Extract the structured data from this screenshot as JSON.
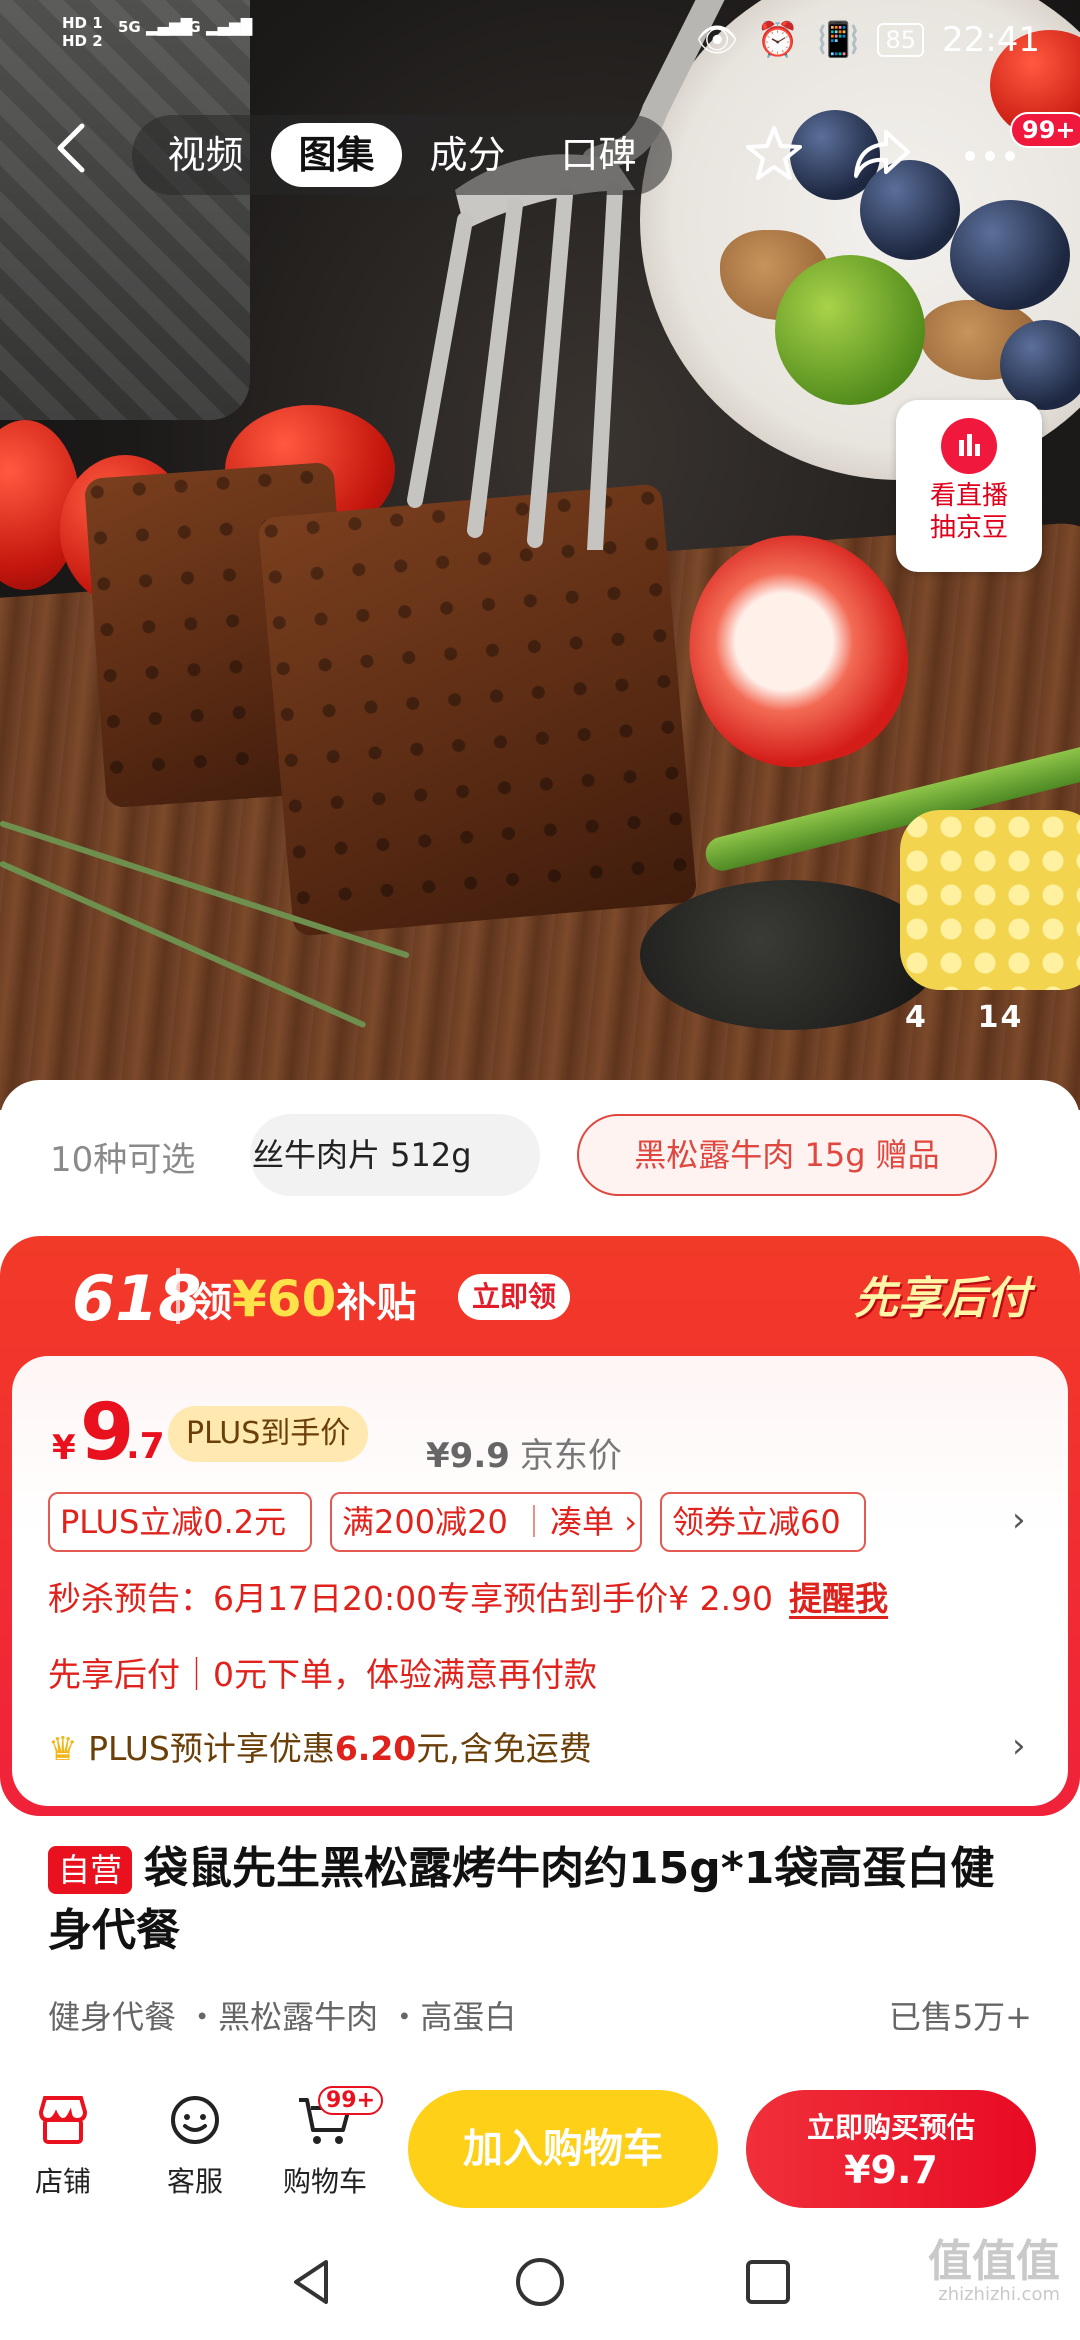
{
  "status_bar": {
    "hd1": "HD 1",
    "hd2": "HD 2",
    "net1": "5G",
    "net2": "4G",
    "battery": "85",
    "time": "22:41"
  },
  "nav": {
    "tabs": [
      "视频",
      "图集",
      "成分",
      "口碑"
    ],
    "active_tab": "图集",
    "more_badge": "99+"
  },
  "live": {
    "line1": "看直播",
    "line2": "抽京豆"
  },
  "gallery": {
    "current": "4",
    "total": "14"
  },
  "variants": {
    "count_label": "10种可选",
    "option1": "丝牛肉片 512g",
    "option2": "黑松露牛肉 15g 赠品"
  },
  "promo": {
    "event": "618",
    "claim_prefix": "领",
    "claim_amount": "¥60",
    "claim_suffix": "补贴",
    "claim_button": "立即领",
    "bnpl": "先享后付"
  },
  "price": {
    "symbol": "¥",
    "integer": "9",
    "decimal": ".7",
    "plus_tag": "PLUS到手价",
    "jd_price": "¥9.9",
    "jd_label": "京东价"
  },
  "coupons": [
    "PLUS立减0.2元",
    "满200减20",
    "凑单",
    "领券立减60"
  ],
  "flash_sale": {
    "text": "秒杀预告：6月17日20:00专享预估到手价¥ 2.90",
    "remind": "提醒我"
  },
  "bnpl_line": "先享后付｜0元下单，体验满意再付款",
  "plus_line": {
    "prefix": "PLUS预计享优惠",
    "value": "6.20",
    "suffix": "元,含免运费"
  },
  "product": {
    "self_tag": "自营",
    "title": "袋鼠先生黑松露烤牛肉约15g*1袋高蛋白健身代餐",
    "features": "健身代餐 ・黑松露牛肉 ・高蛋白",
    "sold": "已售5万+"
  },
  "bottom": {
    "store": "店铺",
    "service": "客服",
    "cart": "购物车",
    "cart_badge": "99+",
    "add_cart": "加入购物车",
    "buy_line1": "立即购买预估",
    "buy_line2": "¥9.7"
  },
  "watermark": {
    "main": "值值值",
    "sub": "zhizhizhi.com"
  },
  "colors": {
    "jd_red": "#e8111d",
    "cart_yellow": "#ffd018",
    "plus_gold": "#ffe9b0"
  },
  "icons": [
    "back-icon",
    "star-icon",
    "share-icon",
    "more-icon",
    "live-icon",
    "store-icon",
    "service-icon",
    "cart-icon",
    "crown-icon"
  ]
}
